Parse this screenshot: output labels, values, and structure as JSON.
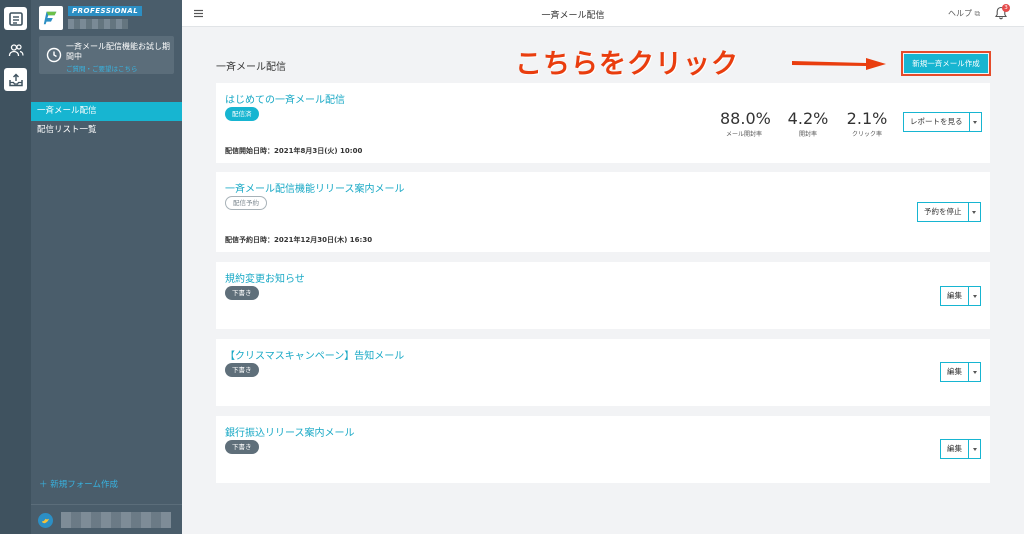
{
  "app": {
    "brand_badge": "PROFESSIONAL",
    "trial_text": "一斉メール配信機能お試し期間中",
    "trial_link": "ご質問・ご要望はこちら",
    "new_form_label": "＋ 新規フォーム作成"
  },
  "sidebar": {
    "items": [
      {
        "label": "一斉メール配信"
      },
      {
        "label": "配信リスト一覧"
      }
    ]
  },
  "topbar": {
    "title": "一斉メール配信",
    "help_label": "ヘルプ",
    "notification_count": "3"
  },
  "main": {
    "title": "一斉メール配信",
    "annotation": "こちらをクリック",
    "new_button_label": "新規一斉メール作成",
    "cards": [
      {
        "title": "はじめての一斉メール配信",
        "status": "配信済",
        "date_text": "配信開始日時：2021年8月3日(火) 10:00",
        "stats": [
          {
            "value": "88.0%",
            "label": "メール開封率"
          },
          {
            "value": "4.2%",
            "label": "開封率"
          },
          {
            "value": "2.1%",
            "label": "クリック率"
          }
        ],
        "action": "レポートを見る"
      },
      {
        "title": "一斉メール配信機能リリース案内メール",
        "status": "配信予約",
        "date_text": "配信予約日時：2021年12月30日(木) 16:30",
        "action": "予約を停止"
      },
      {
        "title": "規約変更お知らせ",
        "status": "下書き",
        "action": "編集"
      },
      {
        "title": "【クリスマスキャンペーン】告知メール",
        "status": "下書き",
        "action": "編集"
      },
      {
        "title": "銀行振込リリース案内メール",
        "status": "下書き",
        "action": "編集"
      }
    ]
  },
  "colors": {
    "accent": "#17b5d1",
    "sidebar": "#4a5d6b",
    "rail": "#3f525f",
    "annotation": "#e93d0e"
  }
}
